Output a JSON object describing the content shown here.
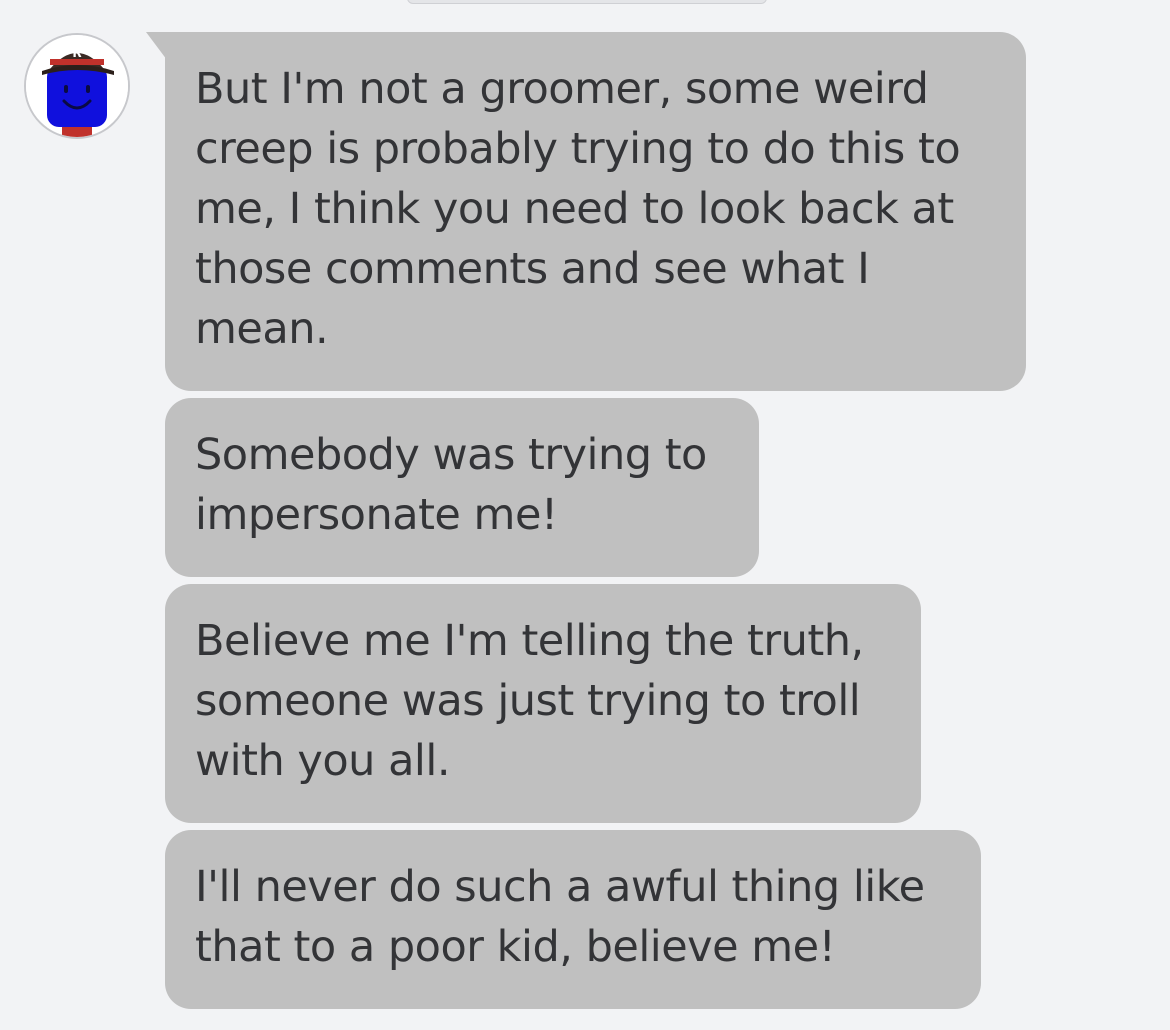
{
  "avatar": {
    "icon": "roblox-avatar-icon",
    "cap_letter": "R",
    "colors": {
      "face": "#1010dd",
      "cap": "#3a2a24",
      "cap_band": "#c0312b"
    }
  },
  "messages": [
    {
      "text": "But I'm not a groomer, some weird creep is probably trying to do this to me, I think you need to look back at those comments and see what I mean."
    },
    {
      "text": "Somebody was trying to impersonate me!"
    },
    {
      "text": "Believe me I'm telling the truth, someone was just trying to troll with you all."
    },
    {
      "text": "I'll never do such a awful thing like that to a poor kid, believe me!"
    }
  ],
  "colors": {
    "background": "#f2f3f5",
    "bubble": "#c0c0c0",
    "text": "#333437"
  }
}
